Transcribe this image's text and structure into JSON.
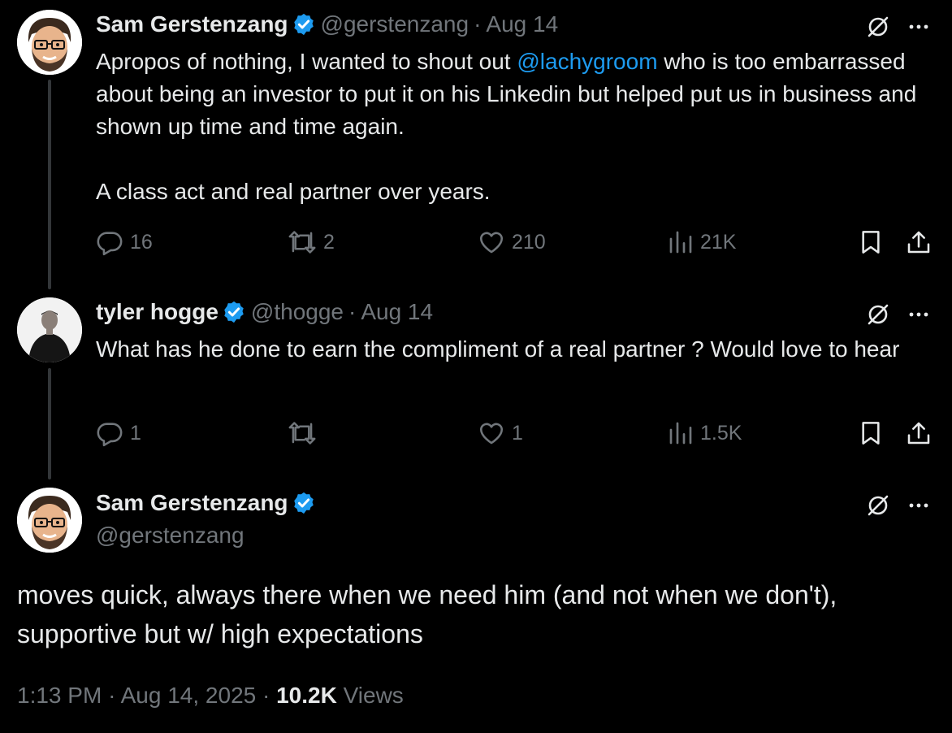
{
  "tweets": [
    {
      "author_name": "Sam Gerstenzang",
      "handle": "@gerstenzang",
      "separator": "·",
      "date": "Aug 14",
      "text_before_mention": "Apropos of nothing, I wanted to shout out ",
      "mention": "@lachygroom",
      "text_after_mention": " who is too embarrassed about being an investor to put it on his Linkedin but helped put us in business and shown up time and time again.",
      "text_paragraph_2": "A class act and real partner over years.",
      "stats": {
        "replies": "16",
        "reposts": "2",
        "likes": "210",
        "views": "21K"
      }
    },
    {
      "author_name": "tyler hogge",
      "handle": "@thogge",
      "separator": "·",
      "date": "Aug 14",
      "text": "What has he done to earn the compliment of a real partner ? Would love to hear",
      "stats": {
        "replies": "1",
        "reposts": "",
        "likes": "1",
        "views": "1.5K"
      }
    }
  ],
  "focused_tweet": {
    "author_name": "Sam Gerstenzang",
    "handle": "@gerstenzang",
    "text_line_1": "moves quick, always there when we need him (and not when we don't),",
    "text_line_2": "supportive but w/ high expectations",
    "time": "1:13 PM",
    "separator": "·",
    "date": "Aug 14, 2025",
    "views_count": "10.2K",
    "views_label": "Views"
  },
  "icons": [
    "grok-icon",
    "more-icon",
    "reply-icon",
    "repost-icon",
    "like-icon",
    "views-icon",
    "bookmark-icon",
    "share-icon",
    "verified-badge-icon"
  ],
  "colors": {
    "background": "#000000",
    "text": "#e7e9ea",
    "muted": "#71767b",
    "link": "#1d9bf0",
    "verified": "#1d9bf0"
  }
}
